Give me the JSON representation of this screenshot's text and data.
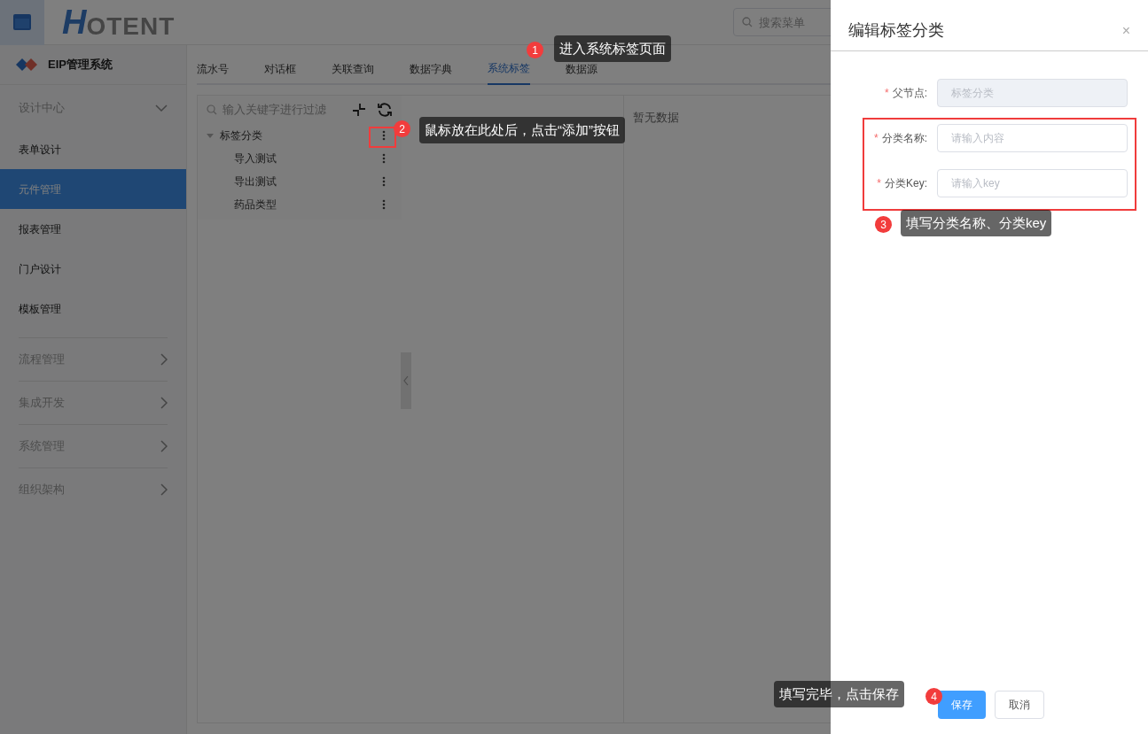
{
  "header": {
    "logo_mark": "H",
    "logo_text": "OTENT",
    "search": {
      "placeholder": "搜索菜单"
    }
  },
  "sidebar": {
    "app_title": "EIP管理系统",
    "groups": [
      {
        "label": "设计中心",
        "expanded": true,
        "children": [
          {
            "label": "表单设计",
            "selected": false
          },
          {
            "label": "元件管理",
            "selected": true
          },
          {
            "label": "报表管理",
            "selected": false
          },
          {
            "label": "门户设计",
            "selected": false
          },
          {
            "label": "模板管理",
            "selected": false
          }
        ]
      },
      {
        "label": "流程管理",
        "expanded": false
      },
      {
        "label": "集成开发",
        "expanded": false
      },
      {
        "label": "系统管理",
        "expanded": false
      },
      {
        "label": "组织架构",
        "expanded": false
      }
    ]
  },
  "tabs": [
    {
      "label": "流水号",
      "selected": false
    },
    {
      "label": "对话框",
      "selected": false
    },
    {
      "label": "关联查询",
      "selected": false
    },
    {
      "label": "数据字典",
      "selected": false
    },
    {
      "label": "系统标签",
      "selected": true
    },
    {
      "label": "数据源",
      "selected": false
    }
  ],
  "tree": {
    "filter_placeholder": "输入关键字进行过滤",
    "nodes": [
      {
        "label": "标签分类",
        "expanded": true,
        "children": [
          {
            "label": "导入测试"
          },
          {
            "label": "导出测试"
          },
          {
            "label": "药品类型"
          }
        ]
      }
    ]
  },
  "detail": {
    "empty_text": "暂无数据"
  },
  "drawer": {
    "title": "编辑标签分类",
    "close": "×",
    "fields": [
      {
        "label": "父节点:",
        "required_mark": "*",
        "placeholder": "标签分类",
        "disabled": true
      },
      {
        "label": "分类名称:",
        "required_mark": "*",
        "placeholder": "请输入内容",
        "disabled": false
      },
      {
        "label": "分类Key:",
        "required_mark": "*",
        "placeholder": "请输入key",
        "disabled": false
      }
    ],
    "buttons": [
      {
        "label": "保存",
        "kind": "primary"
      },
      {
        "label": "取消",
        "kind": "default"
      }
    ]
  },
  "annotations": [
    {
      "number": "1",
      "text": "进入系统标签页面"
    },
    {
      "number": "2",
      "text": "鼠标放在此处后，点击“添加”按钮"
    },
    {
      "number": "3",
      "text": "填写分类名称、分类key"
    },
    {
      "number": "4",
      "text": "填写完毕，点击保存"
    }
  ]
}
